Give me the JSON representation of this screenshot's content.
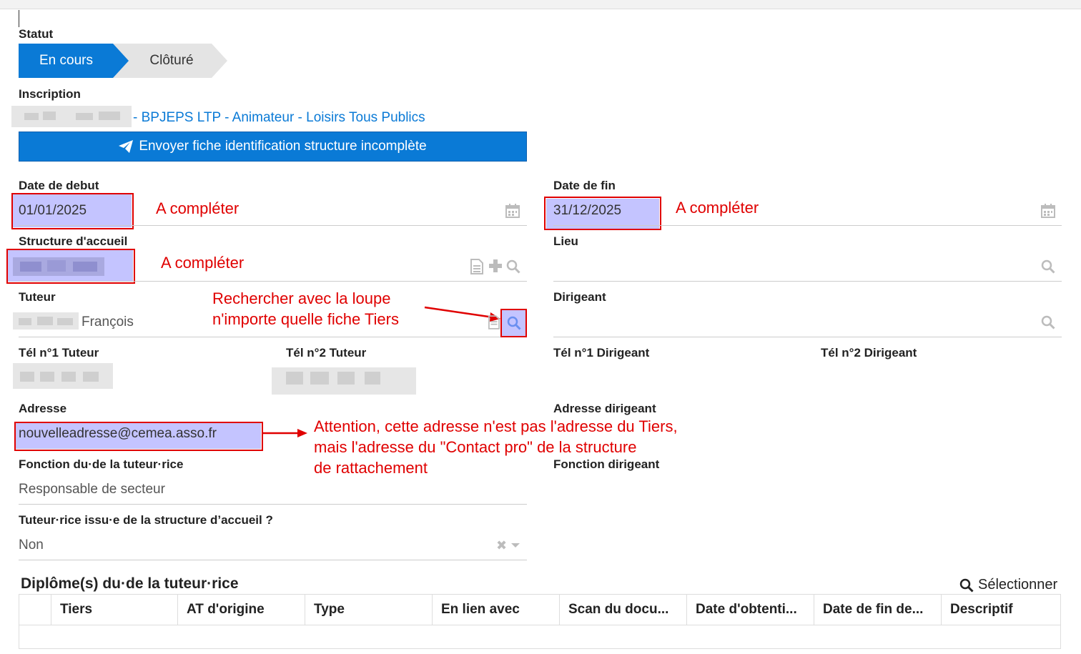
{
  "status": {
    "label": "Statut",
    "steps": [
      {
        "label": "En cours",
        "active": true
      },
      {
        "label": "Clôturé",
        "active": false
      }
    ]
  },
  "inscription": {
    "label": "Inscription",
    "link_text": "- BPJEPS LTP - Animateur - Loisirs Tous Publics"
  },
  "send_button": {
    "label": "Envoyer fiche identification structure incomplète",
    "icon": "paper-plane-icon"
  },
  "fields": {
    "date_debut": {
      "label": "Date de debut",
      "value": "01/01/2025"
    },
    "date_fin": {
      "label": "Date de fin",
      "value": "31/12/2025"
    },
    "structure": {
      "label": "Structure d'accueil"
    },
    "lieu": {
      "label": "Lieu"
    },
    "tuteur": {
      "label": "Tuteur",
      "value": "François"
    },
    "dirigeant": {
      "label": "Dirigeant"
    },
    "tel1_tuteur": {
      "label": "Tél n°1 Tuteur"
    },
    "tel2_tuteur": {
      "label": "Tél n°2 Tuteur"
    },
    "tel1_dirigeant": {
      "label": "Tél n°1 Dirigeant"
    },
    "tel2_dirigeant": {
      "label": "Tél n°2 Dirigeant"
    },
    "adresse": {
      "label": "Adresse",
      "value": "nouvelleadresse@cemea.asso.fr"
    },
    "adresse_dirigeant": {
      "label": "Adresse dirigeant"
    },
    "fonction_tuteur": {
      "label": "Fonction du·de la tuteur·rice",
      "value": "Responsable de secteur"
    },
    "fonction_dirigeant": {
      "label": "Fonction dirigeant"
    },
    "tuteur_issu": {
      "label": "Tuteur·rice issu·e de la structure d’accueil ?",
      "value": "Non"
    }
  },
  "annotations": {
    "a_completer": "A compléter",
    "loupe_line1": "Rechercher avec la loupe",
    "loupe_line2": "n'importe quelle fiche Tiers",
    "adresse_line1": "Attention, cette adresse n'est pas l'adresse du Tiers,",
    "adresse_line2": "mais l'adresse du \"Contact pro\" de la structure",
    "adresse_line3": "de rattachement"
  },
  "diplomes": {
    "title": "Diplôme(s) du·de la tuteur·rice",
    "select_label": "Sélectionner",
    "columns": [
      "Tiers",
      "AT d'origine",
      "Type",
      "En lien avec",
      "Scan du docu...",
      "Date d'obtenti...",
      "Date de fin de...",
      "Descriptif"
    ]
  },
  "colors": {
    "primary": "#0a7ad6",
    "annotation": "#e00000",
    "highlight": "#c4c4ff"
  }
}
